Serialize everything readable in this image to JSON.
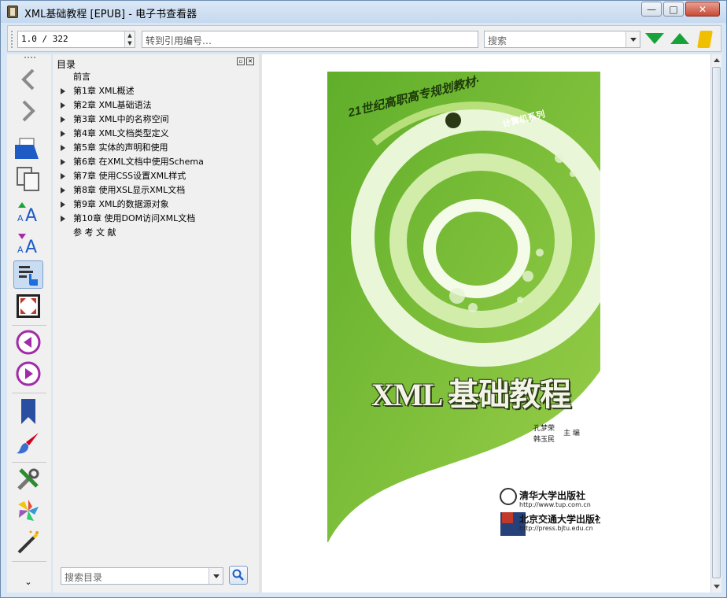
{
  "window": {
    "title": "XML基础教程 [EPUB] - 电子书查看器",
    "controls": {
      "minimize": "—",
      "maximize": "□",
      "close": "✕"
    }
  },
  "toolbar": {
    "page_value": "1.0 / 322",
    "ref_placeholder": "转到引用编号…",
    "search_placeholder": "搜索"
  },
  "sidebar": {
    "icons": [
      "back-icon",
      "forward-icon",
      "open-book-icon",
      "copy-icon",
      "font-larger-icon",
      "font-smaller-icon",
      "toc-icon",
      "fullscreen-icon",
      "previous-page-icon",
      "next-page-icon",
      "bookmark-icon",
      "style-brush-icon",
      "preferences-icon",
      "metadata-icon",
      "magic-wand-icon",
      "more-chevron-icon"
    ]
  },
  "toc": {
    "heading": "目录",
    "items": [
      {
        "label": "前言",
        "expandable": false
      },
      {
        "label": "第1章 XML概述",
        "expandable": true
      },
      {
        "label": "第2章 XML基础语法",
        "expandable": true
      },
      {
        "label": "第3章 XML中的名称空间",
        "expandable": true
      },
      {
        "label": "第4章 XML文档类型定义",
        "expandable": true
      },
      {
        "label": "第5章 实体的声明和使用",
        "expandable": true
      },
      {
        "label": "第6章 在XML文档中使用Schema",
        "expandable": true
      },
      {
        "label": "第7章 使用CSS设置XML样式",
        "expandable": true
      },
      {
        "label": "第8章 使用XSL显示XML文档",
        "expandable": true
      },
      {
        "label": "第9章 XML的数据源对象",
        "expandable": true
      },
      {
        "label": "第10章 使用DOM访问XML文档",
        "expandable": true
      },
      {
        "label": "参 考 文 献",
        "expandable": false
      }
    ],
    "search_placeholder": "搜索目录"
  },
  "cover": {
    "series": "21世纪高职高专规划教材·",
    "series_sub": "计算机系列",
    "title": "XML 基础教程",
    "author1": "孔梦荣",
    "author2": "韩玉民",
    "role": "主 编",
    "publisher1": "清华大学出版社",
    "url1": "http://www.tup.com.cn",
    "publisher2": "北京交通大学出版社",
    "url2": "http://press.bjtu.edu.cn"
  },
  "colors": {
    "accent_green": "#17a33a",
    "cover_green": "#7cbb2e",
    "toolbar_bg": "#f0f0f0"
  }
}
